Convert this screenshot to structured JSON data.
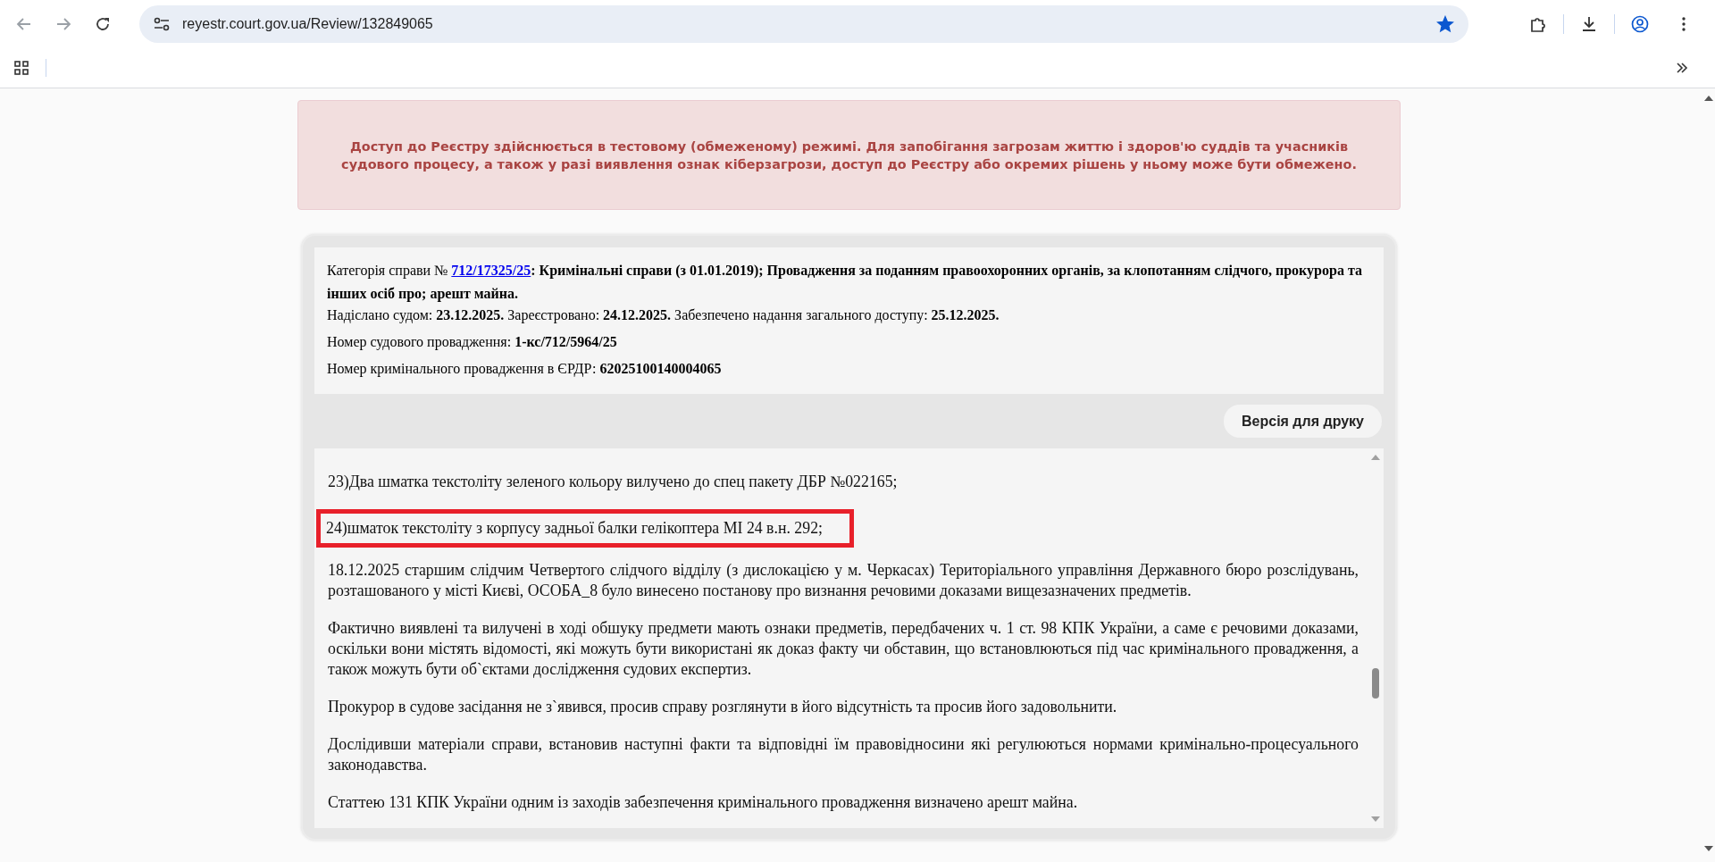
{
  "browser": {
    "url": "reyestr.court.gov.ua/Review/132849065",
    "bookmarked": true
  },
  "banner": {
    "text": "Доступ до Реєстру здійснюється в тестовому (обмеженому) режимі. Для запобігання загрозам життю і здоров'ю суддів та учасників судового процесу, а також у разі виявлення ознак кіберзагрози, доступ до Реєстру або окремих рішень у ньому може бути обмежено."
  },
  "case_info": {
    "category": {
      "label": "Категорія справи № ",
      "link": "712/17325/25",
      "value": "**: Кримінальні справи (з 01.01.2019); Провадження за поданням правоохоронних органів, за клопотанням слідчого, прокурора та інших осіб про; арешт майна.**"
    },
    "lines": [
      "Надіслано судом: **23.12.2025.** Зареєстровано: **24.12.2025.** Забезпечено надання загального доступу: **25.12.2025.**",
      "Номер судового провадження: **1-кс/712/5964/25**",
      "Номер кримінального провадження в ЄРДР: **62025100140004065**"
    ]
  },
  "print_button": {
    "label": "Версія для друку"
  },
  "document": {
    "paragraphs": [
      {
        "text": "23)Два шматка текстоліту зеленого кольору вилучено до спец пакету ДБР №022165;",
        "highlighted": false
      },
      {
        "text": "24)шматок текстоліту з корпусу задньої балки гелікоптера МІ 24 в.н. 292;",
        "highlighted": true
      },
      {
        "text": "18.12.2025 старшим слідчим Четвертого слідчого відділу (з дислокацією у м. Черкасах) Територіального управління Державного бюро розслідувань, розташованого у місті Києві, ОСОБА_8 було винесено постанову про визнання речовими доказами вищезазначених предметів.",
        "highlighted": false
      },
      {
        "text": "Фактично виявлені та вилучені в ході обшуку предмети мають ознаки предметів, передбачених ч. 1 ст. 98 КПК України, а саме є речовими доказами, оскільки вони містять відомості, які можуть бути використані як доказ факту чи обставин, що встановлюються під час кримінального провадження, а також можуть бути об`єктами дослідження судових експертиз.",
        "highlighted": false
      },
      {
        "text": "Прокурор в судове засідання не з`явився, просив справу розглянути в його відсутність та просив його задовольнити.",
        "highlighted": false
      },
      {
        "text": "Дослідивши матеріали справи, встановив наступні факти та відповідні їм правовідносини які регулюються нормами кримінально-процесуального законодавства.",
        "highlighted": false
      },
      {
        "text": "Статтею 131 КПК України одним із заходів забезпечення кримінального провадження визначено арешт майна.",
        "highlighted": false
      }
    ]
  }
}
